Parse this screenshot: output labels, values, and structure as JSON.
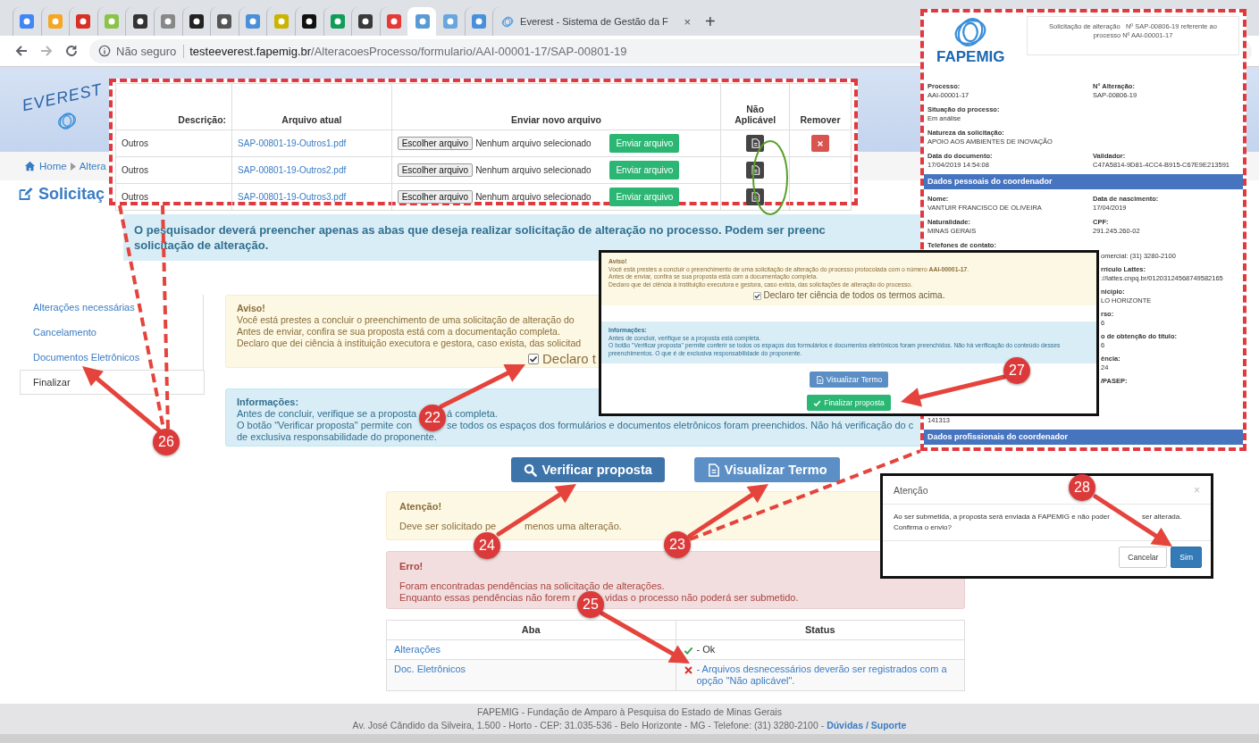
{
  "browser": {
    "pinned_tabs": [
      {
        "selected": false,
        "color": "#4285f4"
      },
      {
        "selected": false,
        "color": "#f5a623"
      },
      {
        "selected": false,
        "color": "#d93025"
      },
      {
        "selected": false,
        "color": "#8bc34a"
      },
      {
        "selected": false,
        "color": "#333333"
      },
      {
        "selected": false,
        "color": "#888888"
      },
      {
        "selected": false,
        "color": "#222222"
      },
      {
        "selected": false,
        "color": "#555555"
      },
      {
        "selected": false,
        "color": "#4a90d9"
      },
      {
        "selected": false,
        "color": "#c9b400"
      },
      {
        "selected": false,
        "color": "#111111"
      },
      {
        "selected": false,
        "color": "#0f9d58"
      },
      {
        "selected": false,
        "color": "#3a3a3a"
      },
      {
        "selected": false,
        "color": "#e53935"
      },
      {
        "selected": true,
        "color": "#5b9bd5"
      },
      {
        "selected": false,
        "color": "#6aa6dd"
      },
      {
        "selected": false,
        "color": "#4a90d9"
      }
    ],
    "tab": {
      "title": "Everest - Sistema de Gestão da F",
      "selected": false,
      "close": "×"
    },
    "new_tab": "+",
    "security": "Não seguro",
    "url_host": "testeeverest.fapemig.br",
    "url_path": "/AlteracoesProcesso/formulario/AAI-00001-17/SAP-00801-19"
  },
  "header": {
    "logo_text": "EVEREST"
  },
  "breadcrumb": [
    "Home",
    "Altera"
  ],
  "page_title": "Solicitaç",
  "banner": [
    "O pesquisador deverá preencher apenas as abas que deseja realizar solicitação de alteração no processo. Podem ser preenc",
    "solicitação de alteração."
  ],
  "sidebar": {
    "items": [
      {
        "label": "Alterações necessárias",
        "selected": false
      },
      {
        "label": "Cancelamento",
        "selected": false
      },
      {
        "label": "Documentos Eletrônicos",
        "selected": false
      },
      {
        "label": "Finalizar",
        "selected": true
      }
    ]
  },
  "aviso": {
    "title": "Aviso!",
    "lines": [
      "Você está prestes a concluir o preenchimento de uma solicitação de alteração do",
      "Antes de enviar, confira se sua proposta está com a documentação completa.",
      "Declaro que dei ciência à instituição executora e gestora, caso exista, das solicitad"
    ],
    "checkbox": {
      "label": "Declaro t",
      "checked": true
    }
  },
  "informacoes": {
    "title": "Informações:",
    "lines": [
      [
        "Antes de concluir, verifique se a proposta",
        "á completa."
      ],
      [
        "O botão \"Verificar proposta\" permite con",
        "se todos os espaços dos formulários e documentos eletrônicos foram preenchidos. Não há verificação do c"
      ],
      [
        "de exclusiva responsabilidade do proponente."
      ]
    ]
  },
  "actions": [
    {
      "label": "Verificar proposta",
      "kind": "search"
    },
    {
      "label": "Visualizar Termo",
      "kind": "document"
    }
  ],
  "alerts": [
    {
      "kind": "warning",
      "title": "Atenção!",
      "lines": [
        [
          "Deve ser solicitado pe",
          "menos uma alteração."
        ]
      ]
    },
    {
      "kind": "danger",
      "title": "Erro!",
      "lines": [
        [
          "Foram encontradas pendências na solicitação de alterações."
        ],
        [
          "Enquanto essas pendências não forem r",
          "vidas o processo não poderá ser submetido."
        ]
      ]
    }
  ],
  "status_table": {
    "columns": [
      "Aba",
      "Status"
    ],
    "rows": [
      {
        "tab": "Alterações",
        "kind": "ok",
        "text": "- Ok"
      },
      {
        "tab": "Doc. Eletrônicos",
        "kind": "error",
        "text": "- Arquivos desnecessários deverão ser registrados com a opção \"Não aplicável\"."
      }
    ]
  },
  "footer": {
    "line1": "FAPEMIG - Fundação de Amparo à Pesquisa do Estado de Minas Gerais",
    "line2": "Av. José Cândido da Silveira, 1.500 - Horto - CEP: 31.035-536 - Belo Horizonte - MG - Telefone: (31) 3280-2100 - ",
    "link": "Dúvidas / Suporte"
  },
  "file_table": {
    "columns": [
      "Descrição:",
      "Arquivo atual",
      "Enviar novo arquivo",
      "Não Aplicável",
      "Remover"
    ],
    "rows": [
      {
        "description": "Outros",
        "file": "SAP-00801-19-Outros1.pdf",
        "choose_button": "Escolher arquivo",
        "chosen": "Nenhum arquivo selecionado",
        "send_button": "Enviar arquivo",
        "removable": true
      },
      {
        "description": "Outros",
        "file": "SAP-00801-19-Outros2.pdf",
        "choose_button": "Escolher arquivo",
        "chosen": "Nenhum arquivo selecionado",
        "send_button": "Enviar arquivo",
        "removable": false
      },
      {
        "description": "Outros",
        "file": "SAP-00801-19-Outros3.pdf",
        "choose_button": "Escolher arquivo",
        "chosen": "Nenhum arquivo selecionado",
        "send_button": "Enviar arquivo",
        "removable": false
      }
    ]
  },
  "document": {
    "logo_text": "FAPEMIG",
    "heading": "Solicitação de alteração   Nº SAP-00806-19 referente ao processo Nº AAI-00001-17",
    "rows": [
      [
        {
          "label": "Processo:",
          "value": "AAI-00001-17"
        },
        {
          "label": "N° Alteração:",
          "value": "SAP-00806-19"
        }
      ],
      [
        {
          "label": "Situação do processo:",
          "value": "Em análise"
        }
      ],
      [
        {
          "label": "Natureza da solicitação:",
          "value": "APOIO AOS AMBIENTES DE INOVAÇÃO"
        }
      ],
      [
        {
          "label": "Data do documento:",
          "value": "17/04/2019 14:54:08"
        },
        {
          "label": "Validador:",
          "value": "C47A5814-9D81-4CC4-B915-C67E9E213591"
        }
      ]
    ],
    "section": "Dados pessoais do coordenador",
    "person_rows": [
      [
        {
          "label": "Nome:",
          "value": "VANTUIR FRANCISCO DE OLIVEIRA"
        },
        {
          "label": "Data de nascimento:",
          "value": "17/04/2019"
        }
      ],
      [
        {
          "label": "Naturalidade:",
          "value": "MINAS GERAIS"
        },
        {
          "label": "CPF:",
          "value": "291.245.260-02"
        }
      ]
    ],
    "contact_label": "Telefones de contato:",
    "fragments": [
      {
        "kind": "value",
        "text": "omercial: (31) 3280-2100"
      },
      {
        "kind": "label",
        "text": "rrículo Lattes:"
      },
      {
        "kind": "value",
        "text": "://lattes.cnpq.br/01203124568749582165"
      },
      {
        "kind": "label",
        "text": "nicípio:"
      },
      {
        "kind": "value",
        "text": "LO HORIZONTE"
      },
      {
        "kind": "label",
        "text": "rso:"
      },
      {
        "kind": "value",
        "text": "6"
      },
      {
        "kind": "label",
        "text": "o de obtenção do título:"
      },
      {
        "kind": "value",
        "text": "6"
      },
      {
        "kind": "label",
        "text": "ência:"
      },
      {
        "kind": "value",
        "text": "24"
      },
      {
        "kind": "label",
        "text": "/PASEP:"
      }
    ],
    "left_value": "141313",
    "section2": "Dados profissionais do coordenador"
  },
  "popup": {
    "aviso_title": "Aviso!",
    "aviso_lines": [
      "Você está prestes a concluir o preenchimento de uma solicitação de alteração do processo protocolada com o número **AAI-00001-17**.",
      "Antes de enviar, confira se sua proposta está com a documentação completa.",
      "Declaro que dei ciência à instituição executora e gestora, caso exista, das solicitações de alteração do processo."
    ],
    "checkbox": {
      "label": "Declaro ter ciência de todos os termos acima.",
      "checked": true
    },
    "info_title": "Informações:",
    "info_lines": [
      "Antes de concluir, verifique se a proposta está completa.",
      "O botão \"Verificar proposta\" permite conferir se todos os espaços dos formulários e documentos eletrônicos foram preenchidos. Não há verificação do conteúdo desses preenchimentos. O que é de exclusiva responsabilidade do proponente."
    ],
    "buttons": [
      {
        "label": "Visualizar Termo",
        "kind": "document"
      },
      {
        "label": "Finalizar proposta",
        "kind": "confirm"
      }
    ]
  },
  "modal": {
    "title": "Atenção",
    "close": "×",
    "lines": [
      [
        "Ao ser submetida, a proposta será enviada à FAPEMIG e não poder",
        "ser alterada."
      ],
      [
        "Confirma o envio?"
      ]
    ],
    "buttons": [
      {
        "label": "Cancelar",
        "kind": "default"
      },
      {
        "label": "Sim",
        "kind": "primary"
      }
    ]
  },
  "annotations": [
    {
      "number": "22"
    },
    {
      "number": "23"
    },
    {
      "number": "24"
    },
    {
      "number": "25"
    },
    {
      "number": "26"
    },
    {
      "number": "27"
    },
    {
      "number": "28"
    }
  ]
}
